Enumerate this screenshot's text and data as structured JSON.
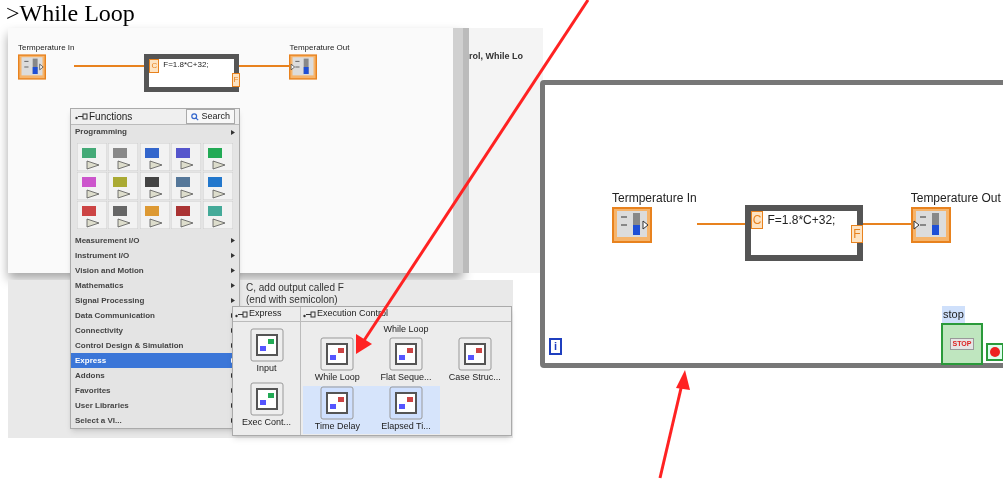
{
  "heading": ">While Loop",
  "left_diagram": {
    "input_label": "Termperature In",
    "output_label": "Temperature Out",
    "in_terminal": "C",
    "formula": "F=1.8*C+32;",
    "out_terminal": "F"
  },
  "background_text": [
    "rol, While Lo",
    "C, add output called F",
    "(end with semicolon)"
  ],
  "functions_palette": {
    "title": "Functions",
    "search": "Search",
    "section": "Programming",
    "categories": [
      {
        "label": "Measurement I/O",
        "selected": false
      },
      {
        "label": "Instrument I/O",
        "selected": false
      },
      {
        "label": "Vision and Motion",
        "selected": false
      },
      {
        "label": "Mathematics",
        "selected": false
      },
      {
        "label": "Signal Processing",
        "selected": false
      },
      {
        "label": "Data Communication",
        "selected": false
      },
      {
        "label": "Connectivity",
        "selected": false
      },
      {
        "label": "Control Design & Simulation",
        "selected": false
      },
      {
        "label": "Express",
        "selected": true
      },
      {
        "label": "Addons",
        "selected": false
      },
      {
        "label": "Favorites",
        "selected": false
      },
      {
        "label": "User Libraries",
        "selected": false
      },
      {
        "label": "Select a VI...",
        "selected": false
      }
    ]
  },
  "express_palette": {
    "title": "Express",
    "items": [
      "Input",
      "Exec Cont..."
    ]
  },
  "execution_palette": {
    "title": "Execution Control",
    "tooltip": "While Loop",
    "items": [
      {
        "label": "While Loop",
        "highlighted": false
      },
      {
        "label": "Flat Seque...",
        "highlighted": false
      },
      {
        "label": "Case Struc...",
        "highlighted": false
      },
      {
        "label": "Time Delay",
        "highlighted": true
      },
      {
        "label": "Elapsed Ti...",
        "highlighted": true
      }
    ]
  },
  "right_diagram": {
    "input_label": "Termperature In",
    "output_label": "Temperature Out",
    "in_terminal": "C",
    "formula": "F=1.8*C+32;",
    "out_terminal": "F",
    "stop_label": "stop",
    "stop_button": "STOP",
    "iteration": "i"
  }
}
